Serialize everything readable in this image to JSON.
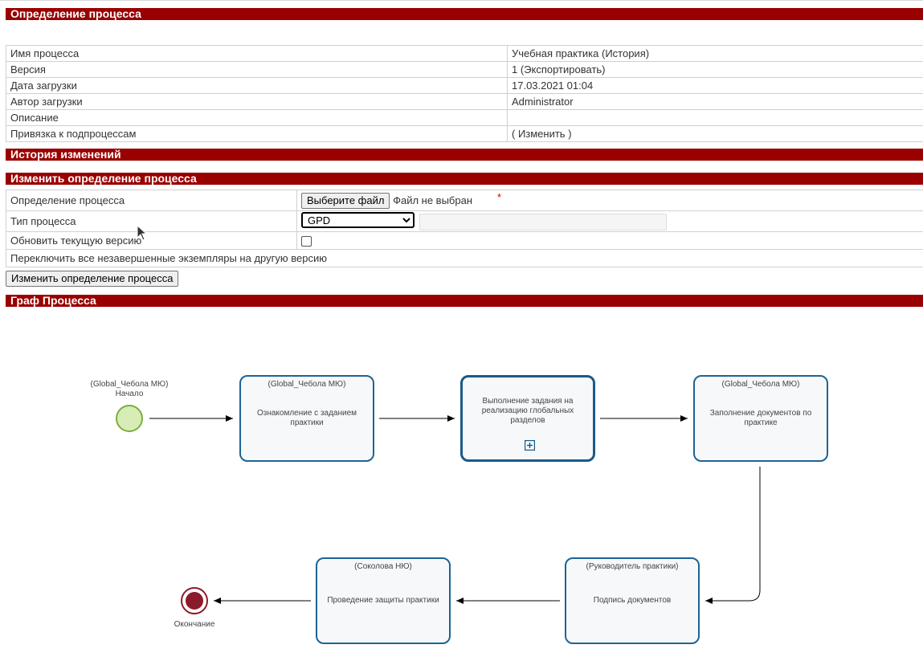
{
  "sections": {
    "definition": "Определение процесса",
    "history": "История изменений",
    "change": "Изменить определение процесса",
    "graph": "Граф Процесса"
  },
  "properties": [
    {
      "label": "Имя процесса",
      "value": "Учебная практика (История)"
    },
    {
      "label": "Версия",
      "value": "1 (Экспортировать)"
    },
    {
      "label": "Дата загрузки",
      "value": "17.03.2021 01:04"
    },
    {
      "label": "Автор загрузки",
      "value": "Administrator"
    },
    {
      "label": "Описание",
      "value": ""
    },
    {
      "label": "Привязка к подпроцессам",
      "value": "( Изменить )"
    }
  ],
  "edit_form": {
    "definition_label": "Определение процесса",
    "choose_file_button": "Выберите файл",
    "no_file_text": "Файл не выбран",
    "required_mark": "*",
    "type_label": "Тип процесса",
    "type_selected": "GPD",
    "update_label": "Обновить текущую версию",
    "switch_label": "Переключить все незавершенные экземпляры на другую версию",
    "submit_button": "Изменить определение процесса"
  },
  "graph": {
    "start_lane": "(Global_Чебола МЮ)",
    "start_label": "Начало",
    "end_label": "Окончание",
    "tasks": [
      {
        "lane": "(Global_Чебола МЮ)",
        "name": "Ознакомление с заданием практики"
      },
      {
        "lane": "",
        "name": "Выполнение задания на реализацию глобальных разделов",
        "subprocess_marker": "⊞"
      },
      {
        "lane": "(Global_Чебола МЮ)",
        "name": "Заполнение документов по практике"
      },
      {
        "lane": "(Руководитель практики)",
        "name": "Подпись документов"
      },
      {
        "lane": "(Соколова НЮ)",
        "name": "Проведение защиты практики"
      }
    ]
  },
  "colors": {
    "section_bar": "#990000",
    "task_border": "#1d6494",
    "start_event": "#8bc34a",
    "end_event": "#8b1a2b"
  },
  "icons": {
    "cursor": "mouse-pointer-icon",
    "subprocess": "plus-square-icon"
  }
}
